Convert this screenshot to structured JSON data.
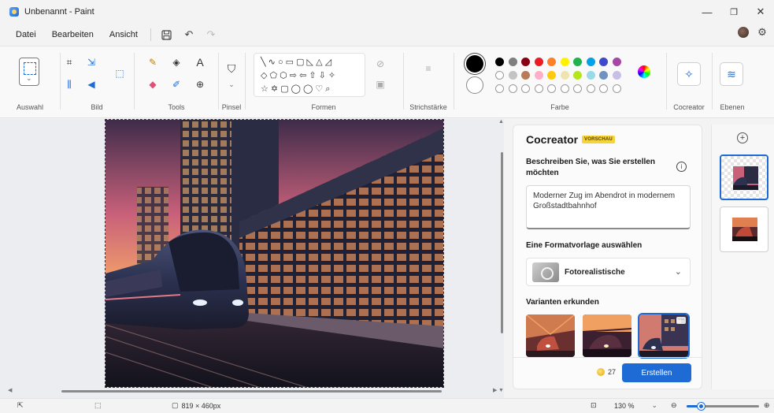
{
  "window": {
    "title": "Unbenannt - Paint",
    "minimize": "—",
    "maximize": "❐",
    "close": "✕"
  },
  "menu": {
    "items": [
      "Datei",
      "Bearbeiten",
      "Ansicht"
    ],
    "save_icon": "💾",
    "undo_icon": "↶",
    "redo_icon": "↷"
  },
  "ribbon": {
    "groups": {
      "selection": "Auswahl",
      "image": "Bild",
      "tools": "Tools",
      "brushes": "Pinsel",
      "shapes": "Formen",
      "stroke": "Strichstärke",
      "color": "Farbe",
      "cocreator": "Cocreator",
      "layers": "Ebenen"
    },
    "tool_glyphs": {
      "crop": "⌗",
      "resize": "⇲",
      "rotate": "◀",
      "select_image": "⬚",
      "pencil": "✎",
      "fill": "◈",
      "text": "A",
      "eraser": "◆",
      "picker": "✐",
      "magnifier": "⊕",
      "brush": "⛉"
    },
    "shape_rows": [
      "╲ ∿ ○ ▭ ▢ ◺ △ ◿",
      "◇ ⬠ ⬡ ⇨ ⇦ ⇧ ⇩ ✧",
      "☆ ✡ ▢ ◯ ◯ ♡ ⌕"
    ],
    "colors": {
      "primary": "#000000",
      "secondary": "#ffffff",
      "row1": [
        "#000000",
        "#7f7f7f",
        "#880015",
        "#ed1c24",
        "#ff7f27",
        "#fff200",
        "#22b14c",
        "#00a2e8",
        "#3f48cc",
        "#a349a4"
      ],
      "row2": [
        "#ffffff",
        "#c3c3c3",
        "#b97a57",
        "#ffaec9",
        "#ffc90e",
        "#efe4b0",
        "#b5e61d",
        "#99d9ea",
        "#7092be",
        "#c8bfe7"
      ],
      "row3_empty_count": 10
    }
  },
  "cocreator": {
    "title": "Cocreator",
    "badge": "VORSCHAU",
    "describe_label_line1": "Beschreiben Sie, was Sie erstellen",
    "describe_label_line2": "möchten",
    "prompt": "Moderner Zug im Abendrot in modernem Großstadtbahnhof",
    "style_label": "Eine Formatvorlage auswählen",
    "style_value": "Fotorealistische",
    "variants_label": "Varianten erkunden",
    "credits": "27",
    "create_button": "Erstellen",
    "more": "···"
  },
  "layers": {
    "add": "+"
  },
  "status": {
    "dimensions": "819 × 460px",
    "zoom": "130 %",
    "zoom_level": 0.2,
    "zoom_out": "⊖",
    "zoom_in": "⊕"
  }
}
